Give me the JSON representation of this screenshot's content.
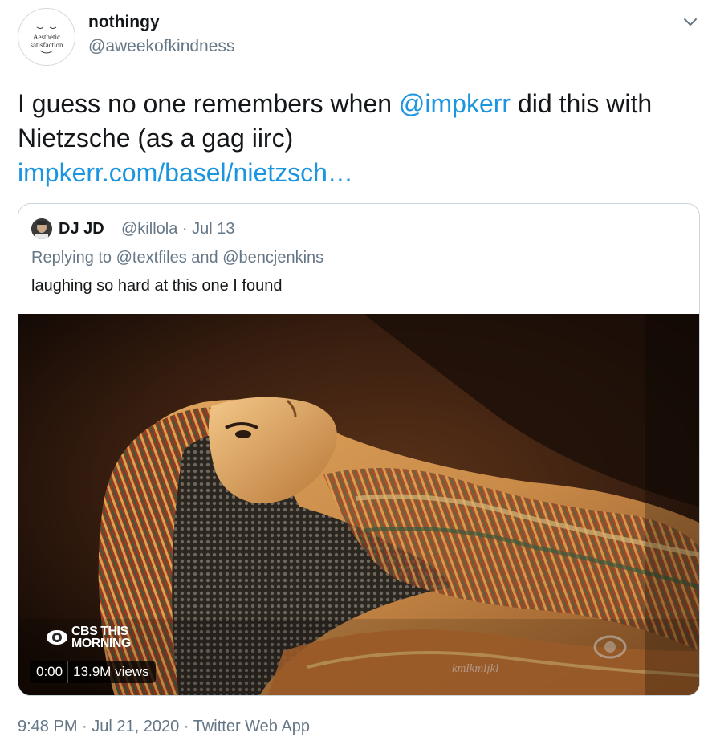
{
  "author": {
    "display_name": "nothingy",
    "handle": "@aweekofkindness",
    "avatar_text_line1": "Aesthetic",
    "avatar_text_line2": "satisfaction"
  },
  "tweet": {
    "text_before": "I guess no one remembers when ",
    "mention": "@impkerr",
    "text_after": " did this with Nietzsche (as a gag iirc)",
    "link": "impkerr.com/basel/nietzsch…"
  },
  "quoted_tweet": {
    "display_name": "DJ JD",
    "handle": "@killola",
    "separator": "·",
    "date": "Jul 13",
    "replying_prefix": "Replying to ",
    "reply_mention_1": "@textfiles",
    "reply_and": " and ",
    "reply_mention_2": "@bencjenkins",
    "text": "laughing so hard at this one I found",
    "video": {
      "logo_line1": "CBS THIS",
      "logo_line2": "MORNING",
      "time": "0:00",
      "views": "13.9M views",
      "watermark": "kmlkmljkl"
    }
  },
  "footer": {
    "time": "9:48 PM",
    "dot1": "·",
    "date": "Jul 21, 2020",
    "dot2": "·",
    "source": "Twitter Web App"
  },
  "colors": {
    "link": "#1b95e0",
    "secondary_text": "#657786",
    "border": "#ccd6dd"
  },
  "icons": [
    "chevron-down-icon",
    "cbs-eye-icon",
    "play-video"
  ]
}
